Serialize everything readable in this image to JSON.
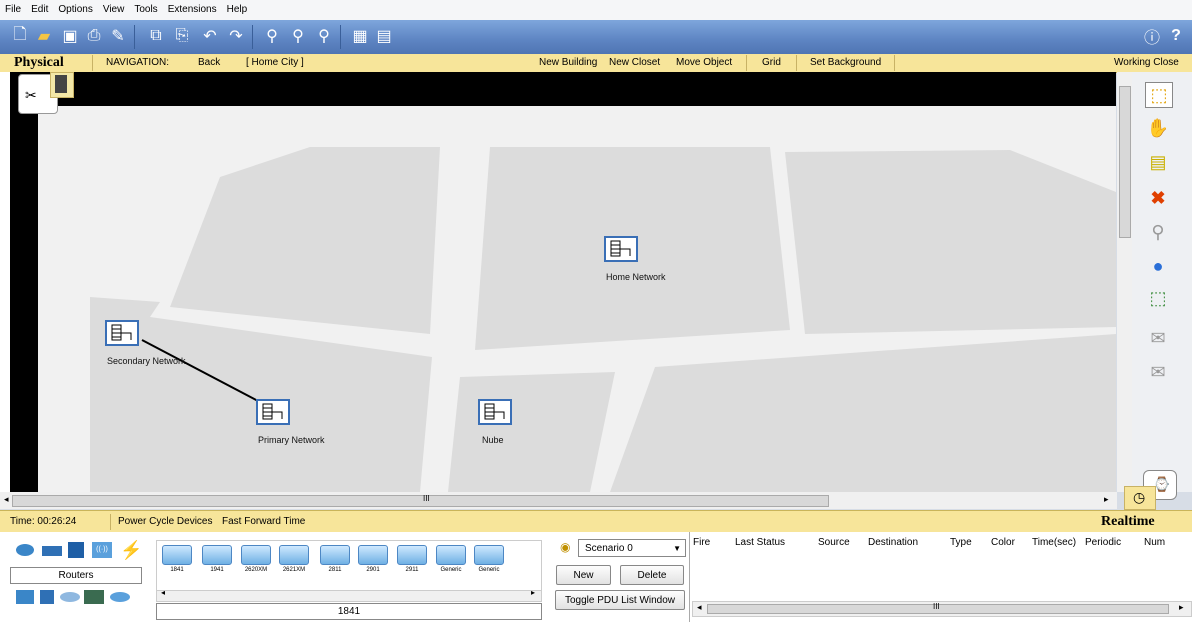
{
  "menu": [
    "File",
    "Edit",
    "Options",
    "View",
    "Tools",
    "Extensions",
    "Help"
  ],
  "navbar": {
    "tab": "Physical",
    "navigation": "NAVIGATION:",
    "back": "Back",
    "location": "[ Home City ]",
    "new_building": "New Building",
    "new_closet": "New Closet",
    "move_object": "Move Object",
    "grid": "Grid",
    "set_background": "Set Background",
    "working_closet": "Working Close"
  },
  "workspace": {
    "devices": [
      {
        "label": "Home Network"
      },
      {
        "label": "Secondary Network"
      },
      {
        "label": "Primary Network"
      },
      {
        "label": "Nube"
      }
    ],
    "hscroll_label": "III"
  },
  "statusbar": {
    "time": "Time: 00:26:24",
    "power_cycle": "Power Cycle Devices",
    "fast_forward": "Fast Forward Time",
    "mode": "Realtime"
  },
  "device_panel": {
    "category": "Routers",
    "selected_model": "1841",
    "models": [
      "1841",
      "1941",
      "2620XM",
      "2621XM",
      "2811",
      "2901",
      "2911",
      "Generic",
      "Generic"
    ]
  },
  "scenario": {
    "selected": "Scenario 0",
    "new": "New",
    "delete": "Delete",
    "toggle": "Toggle PDU List Window"
  },
  "pdu_columns": [
    "Fire",
    "Last Status",
    "Source",
    "Destination",
    "Type",
    "Color",
    "Time(sec)",
    "Periodic",
    "Num"
  ],
  "pdu_scroll_label": "III",
  "colors": {
    "toolbar": "#5d84c2",
    "navbar": "#f7e59a",
    "device_border": "#3a6fb6"
  }
}
